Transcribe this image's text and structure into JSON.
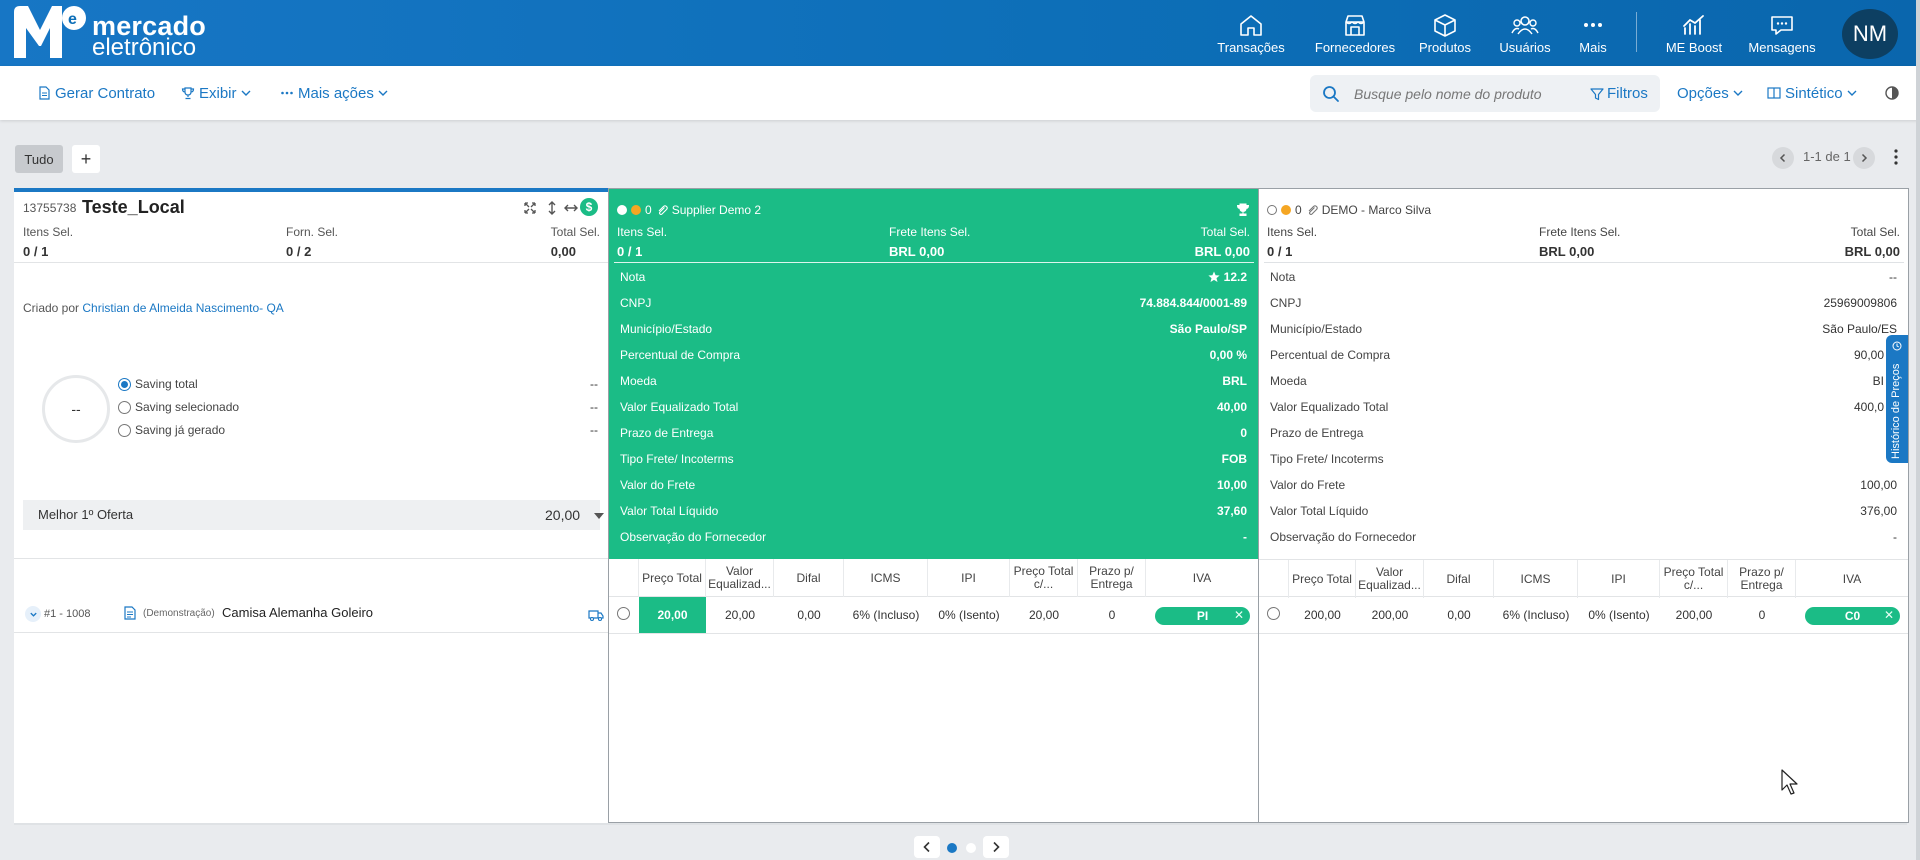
{
  "brand": {
    "name_line1": "mercado",
    "name_line2": "eletrônico"
  },
  "nav": {
    "items": [
      {
        "label": "Transações",
        "icon": "home-icon"
      },
      {
        "label": "Fornecedores",
        "icon": "store-icon"
      },
      {
        "label": "Produtos",
        "icon": "box-icon"
      },
      {
        "label": "Usuários",
        "icon": "users-icon"
      },
      {
        "label": "Mais",
        "icon": "more-icon"
      },
      {
        "label": "ME Boost",
        "icon": "chart-icon"
      },
      {
        "label": "Mensagens",
        "icon": "message-icon"
      }
    ],
    "avatar_initials": "NM"
  },
  "toolbar": {
    "gerar_contrato": "Gerar Contrato",
    "exibir": "Exibir",
    "mais_acoes": "Mais ações",
    "search_placeholder": "Busque pelo nome do produto",
    "filtros": "Filtros",
    "opcoes": "Opções",
    "sintetico": "Sintético"
  },
  "tabs": {
    "tudo": "Tudo",
    "add": "+"
  },
  "pagination": {
    "text": "1-1 de 1"
  },
  "left": {
    "id": "13755738",
    "title": "Teste_Local",
    "itens_sel_label": "Itens Sel.",
    "itens_sel_value": "0 / 1",
    "forn_sel_label": "Forn. Sel.",
    "forn_sel_value": "0 / 2",
    "total_sel_label": "Total Sel.",
    "total_sel_value": "0,00",
    "criado_prefix": "Criado por",
    "criado_by": "Christian de Almeida Nascimento- QA",
    "saving_center": "--",
    "saving_options": [
      {
        "label": "Saving total",
        "value": "--",
        "selected": true
      },
      {
        "label": "Saving selecionado",
        "value": "--",
        "selected": false
      },
      {
        "label": "Saving já gerado",
        "value": "--",
        "selected": false
      }
    ],
    "melhor_label": "Melhor 1º Oferta",
    "melhor_value": "20,00",
    "item": {
      "number": "#1 - 1008",
      "prefix": "(Demonstração)",
      "name": "Camisa Alemanha Goleiro"
    }
  },
  "suppliers": [
    {
      "counter": "0",
      "name": "Supplier Demo 2",
      "itens_sel_label": "Itens Sel.",
      "itens_sel_value": "0 / 1",
      "frete_label": "Frete Itens Sel.",
      "frete_value": "BRL 0,00",
      "total_label": "Total Sel.",
      "total_value": "BRL 0,00",
      "details": [
        {
          "k": "Nota",
          "v": "12.2"
        },
        {
          "k": "CNPJ",
          "v": "74.884.844/0001-89"
        },
        {
          "k": "Município/Estado",
          "v": "São Paulo/SP"
        },
        {
          "k": "Percentual de Compra",
          "v": "0,00 %"
        },
        {
          "k": "Moeda",
          "v": "BRL"
        },
        {
          "k": "Valor Equalizado Total",
          "v": "40,00"
        },
        {
          "k": "Prazo de Entrega",
          "v": "0"
        },
        {
          "k": "Tipo Frete/ Incoterms",
          "v": "FOB"
        },
        {
          "k": "Valor do Frete",
          "v": "10,00"
        },
        {
          "k": "Valor Total Líquido",
          "v": "37,60"
        },
        {
          "k": "Observação do Fornecedor",
          "v": "-"
        }
      ],
      "row": {
        "preco_total": "20,00",
        "valor_eq": "20,00",
        "difal": "0,00",
        "icms": "6% (Incluso)",
        "ipi": "0% (Isento)",
        "preco_total_c": "20,00",
        "prazo": "0",
        "iva": "PI"
      }
    },
    {
      "counter": "0",
      "name": "DEMO - Marco Silva",
      "itens_sel_label": "Itens Sel.",
      "itens_sel_value": "0 / 1",
      "frete_label": "Frete Itens Sel.",
      "frete_value": "BRL 0,00",
      "total_label": "Total Sel.",
      "total_value": "BRL 0,00",
      "details": [
        {
          "k": "Nota",
          "v": "--"
        },
        {
          "k": "CNPJ",
          "v": "25969009806"
        },
        {
          "k": "Município/Estado",
          "v": "São Paulo/ES"
        },
        {
          "k": "Percentual de Compra",
          "v": "90,00"
        },
        {
          "k": "Moeda",
          "v": "BI"
        },
        {
          "k": "Valor Equalizado Total",
          "v": "400,0"
        },
        {
          "k": "Prazo de Entrega",
          "v": ""
        },
        {
          "k": "Tipo Frete/ Incoterms",
          "v": ""
        },
        {
          "k": "Valor do Frete",
          "v": "100,00"
        },
        {
          "k": "Valor Total Líquido",
          "v": "376,00"
        },
        {
          "k": "Observação do Fornecedor",
          "v": "-"
        }
      ],
      "row": {
        "preco_total": "200,00",
        "valor_eq": "200,00",
        "difal": "0,00",
        "icms": "6% (Incluso)",
        "ipi": "0% (Isento)",
        "preco_total_c": "200,00",
        "prazo": "0",
        "iva": "C0"
      }
    }
  ],
  "table_headers": {
    "preco_total": "Preço Total",
    "valor_eq_1": "Valor",
    "valor_eq_2": "Equalizad...",
    "difal": "Difal",
    "icms": "ICMS",
    "ipi": "IPI",
    "preco_c_1": "Preço Total",
    "preco_c_2": "c/...",
    "prazo_1": "Prazo p/",
    "prazo_2": "Entrega",
    "iva": "IVA"
  },
  "side_tab": {
    "label": "Histórico de Preços"
  },
  "colors": {
    "green": "#1bbc86",
    "blue": "#1b78c4",
    "header": "#0d6fb8"
  }
}
